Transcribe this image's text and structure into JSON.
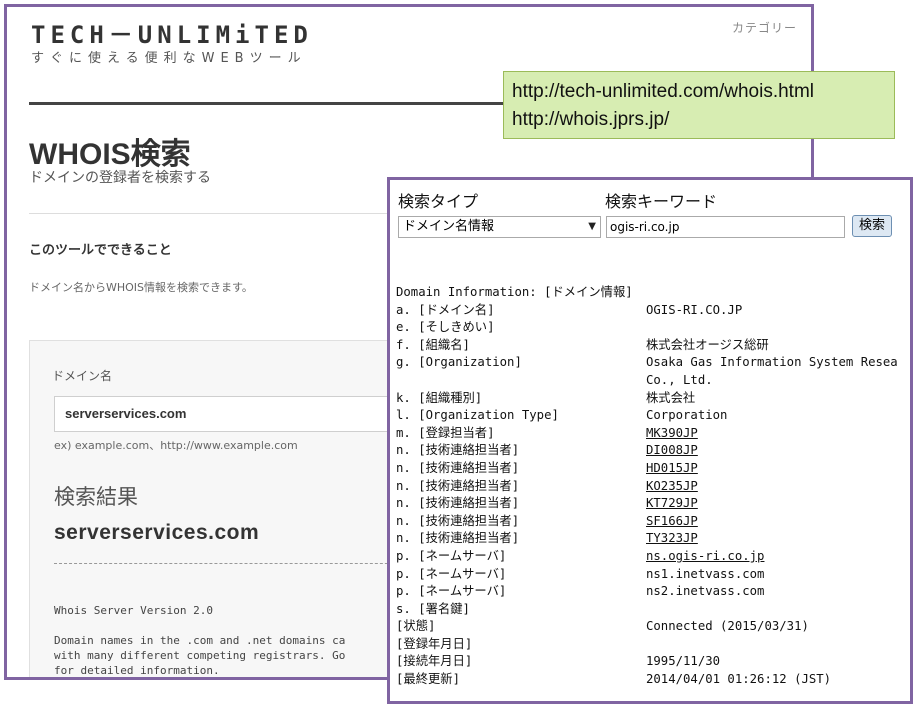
{
  "back": {
    "logo": "TECH－UNLIMiTED",
    "tagline": "すぐに使える便利なWEBツール",
    "category": "カテゴリー",
    "title": "WHOIS検索",
    "subtitle": "ドメインの登録者を検索する",
    "features_heading": "このツールでできること",
    "features_desc": "ドメイン名からWHOIS情報を検索できます。",
    "domain_label": "ドメイン名",
    "domain_value": "serverservices.com",
    "example": "ex)  example.com、http://www.example.com",
    "result_title": "検索結果",
    "result_domain": "serverservices.com",
    "raw_line1": "Whois Server Version 2.0",
    "raw_line2": "Domain names in the .com and .net domains ca",
    "raw_line3": "with many different competing registrars. Go",
    "raw_line4": "for detailed information."
  },
  "callout": {
    "url1": "http://tech-unlimited.com/whois.html",
    "url2": "http://whois.jprs.jp/"
  },
  "front": {
    "search_type_label": "検索タイプ",
    "keyword_label": "検索キーワード",
    "search_type_value": "ドメイン名情報",
    "keyword_value": "ogis-ri.co.jp",
    "search_button": "検索",
    "header": "Domain Information: [ドメイン情報]",
    "rows": [
      {
        "k": "a. [ドメイン名]",
        "v": "OGIS-RI.CO.JP"
      },
      {
        "k": "e. [そしきめい]",
        "v": ""
      },
      {
        "k": "f. [組織名]",
        "v": "株式会社オージス総研"
      },
      {
        "k": "g. [Organization]",
        "v": "Osaka Gas Information System Resea\nCo., Ltd."
      },
      {
        "k": "k. [組織種別]",
        "v": "株式会社"
      },
      {
        "k": "l. [Organization Type]",
        "v": "Corporation"
      },
      {
        "k": "m. [登録担当者]",
        "v": "MK390JP"
      },
      {
        "k": "n. [技術連絡担当者]",
        "v": "DI008JP"
      },
      {
        "k": "n. [技術連絡担当者]",
        "v": "HD015JP"
      },
      {
        "k": "n. [技術連絡担当者]",
        "v": "KO235JP"
      },
      {
        "k": "n. [技術連絡担当者]",
        "v": "KT729JP"
      },
      {
        "k": "n. [技術連絡担当者]",
        "v": "SF166JP"
      },
      {
        "k": "n. [技術連絡担当者]",
        "v": "TY323JP"
      },
      {
        "k": "p. [ネームサーバ]",
        "v": "ns.ogis-ri.co.jp"
      },
      {
        "k": "p. [ネームサーバ]",
        "v": "ns1.inetvass.com"
      },
      {
        "k": "p. [ネームサーバ]",
        "v": "ns2.inetvass.com"
      },
      {
        "k": "s. [署名鍵]",
        "v": ""
      },
      {
        "k": "[状態]",
        "v": "Connected (2015/03/31)"
      },
      {
        "k": "[登録年月日]",
        "v": ""
      },
      {
        "k": "[接続年月日]",
        "v": "1995/11/30"
      },
      {
        "k": "[最終更新]",
        "v": "2014/04/01 01:26:12 (JST)"
      }
    ]
  }
}
